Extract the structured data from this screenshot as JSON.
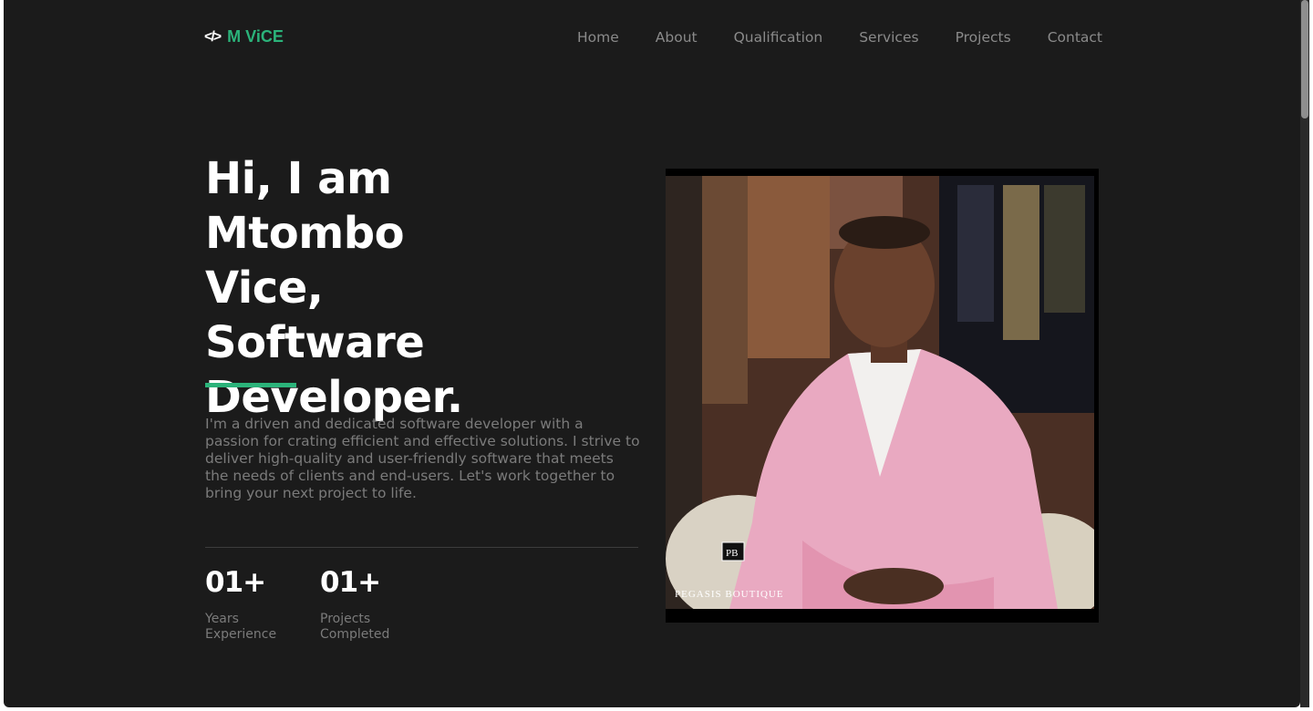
{
  "logo": {
    "text": "M ViCE",
    "icon": "code-icon"
  },
  "nav": [
    "Home",
    "About",
    "Qualification",
    "Services",
    "Projects",
    "Contact"
  ],
  "hero": {
    "headline_lines": [
      "Hi, I am Mtombo",
      "Vice,",
      "Software",
      "Developer."
    ],
    "intro": "I'm a driven and dedicated software developer with a passion for crating efficient and effective solutions. I strive to deliver high-quality and user-friendly software that meets the needs of clients and end-users. Let's work together to bring your next project to life."
  },
  "stats": [
    {
      "value": "01+",
      "label": "Years Experience"
    },
    {
      "value": "01+",
      "label": "Projects Completed"
    }
  ],
  "photo": {
    "watermark": "PEGASIS BOUTIQUE",
    "watermark_mark": "PB"
  },
  "colors": {
    "accent": "#2bb37a",
    "background": "#1b1b1b",
    "text_muted": "#7b7b7b"
  }
}
